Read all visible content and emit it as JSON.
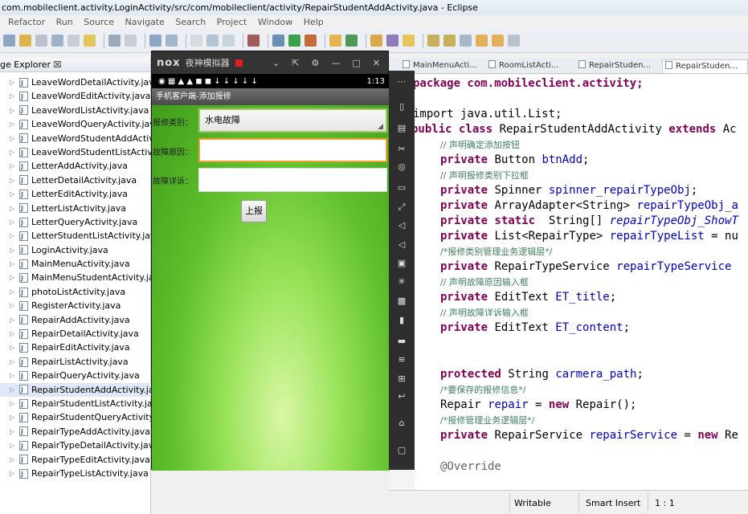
{
  "window": {
    "title": "com.mobileclient.activity.LoginActivity/src/com/mobileclient/activity/RepairStudentAddActivity.java - Eclipse"
  },
  "menu": [
    "Refactor",
    "Run",
    "Source",
    "Navigate",
    "Search",
    "Project",
    "Window",
    "Help"
  ],
  "explorer": {
    "title": "ge Explorer ☒",
    "items": [
      {
        "label": "LeaveWordDetailActivity.java"
      },
      {
        "label": "LeaveWordEditActivity.java"
      },
      {
        "label": "LeaveWordListActivity.java"
      },
      {
        "label": "LeaveWordQueryActivity.java"
      },
      {
        "label": "LeaveWordStudentAddActivit"
      },
      {
        "label": "LeaveWordStudentListActivity"
      },
      {
        "label": "LetterAddActivity.java"
      },
      {
        "label": "LetterDetailActivity.java"
      },
      {
        "label": "LetterEditActivity.java"
      },
      {
        "label": "LetterListActivity.java"
      },
      {
        "label": "LetterQueryActivity.java"
      },
      {
        "label": "LetterStudentListActivity.java"
      },
      {
        "label": "LoginActivity.java"
      },
      {
        "label": "MainMenuActivity.java"
      },
      {
        "label": "MainMenuStudentActivity.jav"
      },
      {
        "label": "photoListActivity.java"
      },
      {
        "label": "RegisterActivity.java"
      },
      {
        "label": "RepairAddActivity.java"
      },
      {
        "label": "RepairDetailActivity.java"
      },
      {
        "label": "RepairEditActivity.java"
      },
      {
        "label": "RepairListActivity.java"
      },
      {
        "label": "RepairQueryActivity.java"
      },
      {
        "label": "RepairStudentAddActivity.jav"
      },
      {
        "label": "RepairStudentListActivity.jav"
      },
      {
        "label": "RepairStudentQueryActivity.ja"
      },
      {
        "label": "RepairTypeAddActivity.java"
      },
      {
        "label": "RepairTypeDetailActivity.java"
      },
      {
        "label": "RepairTypeEditActivity.java"
      },
      {
        "label": "RepairTypeListActivity.java"
      }
    ]
  },
  "emulator": {
    "logo": "nox",
    "title": "夜神模拟器",
    "rec_mark": "!",
    "clock": "1:13",
    "app_title": "手机客户端-添加报修",
    "form": {
      "type_label": "报修类别：",
      "type_value": "水电故障",
      "reason_label": "故障原因：",
      "reason_value": "",
      "detail_label": "故障详诉：",
      "detail_value": "",
      "submit_label": "上报"
    }
  },
  "editor": {
    "tabs": [
      {
        "label": "MainMenuActi..."
      },
      {
        "label": "RoomListActi..."
      },
      {
        "label": "RepairStuden..."
      },
      {
        "label": "RepairStuden..."
      }
    ],
    "lines": {
      "l1": "package com.mobileclient.activity;",
      "l2": "import java.util.List;",
      "l3a": "public class ",
      "l3b": "RepairStudentAddActivity ",
      "l3c": "extends ",
      "l3d": "Ac",
      "c1": "// 声明确定添加按钮",
      "l4a": "private ",
      "l4b": "Button ",
      "l4c": "btnAdd",
      "l4d": ";",
      "c2": "// 声明报修类别下拉框",
      "l5a": "private ",
      "l5b": "Spinner ",
      "l5c": "spinner_repairTypeObj",
      "l5d": ";",
      "l6a": "private ",
      "l6b": "ArrayAdapter<String> ",
      "l6c": "repairTypeObj_a",
      "l7a": "private static ",
      "l7b": " String[] ",
      "l7c": "repairTypeObj_ShowT",
      "l8a": "private ",
      "l8b": "List<RepairType> ",
      "l8c": "repairTypeList",
      "l8d": " = nu",
      "c3": "/*报修类别管理业务逻辑层*/",
      "l9a": "private ",
      "l9b": "RepairTypeService ",
      "l9c": "repairTypeService",
      "c4": "// 声明故障原因输入框",
      "l10a": "private ",
      "l10b": "EditText ",
      "l10c": "ET_title",
      "l10d": ";",
      "c5": "// 声明故障详诉输入框",
      "l11a": "private ",
      "l11b": "EditText ",
      "l11c": "ET_content",
      "l11d": ";",
      "l12a": "protected ",
      "l12b": "String ",
      "l12c": "carmera_path",
      "l12d": ";",
      "c6": "/*要保存的报修信息*/",
      "l13a": "Repair ",
      "l13b": "repair",
      "l13c": " = ",
      "l13d": "new ",
      "l13e": "Repair();",
      "c7": "/*报修管理业务逻辑层*/",
      "l14a": "private ",
      "l14b": "RepairService ",
      "l14c": "repairService",
      "l14d": " = ",
      "l14e": "new ",
      "l14f": "Re",
      "l15": "@Override"
    }
  },
  "status": {
    "writable": "Writable",
    "insert": "Smart Insert",
    "pos": "1 : 1"
  },
  "colors": {
    "keyword": "#7f0055",
    "comment": "#3f7f5f",
    "field": "#0000c0",
    "app_green": "#5fc02b"
  }
}
